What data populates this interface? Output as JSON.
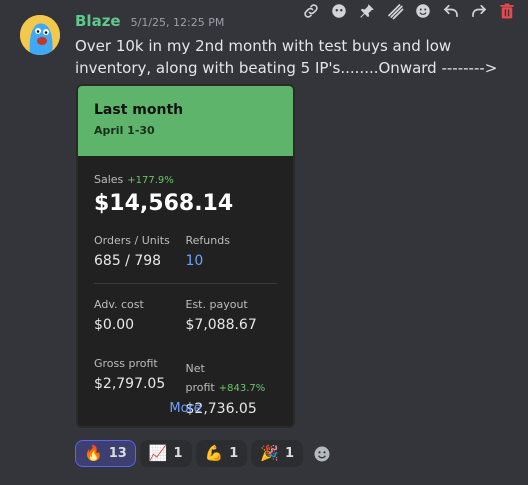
{
  "toolbar": {
    "icons": [
      "link-icon",
      "thread-icon",
      "pin-icon",
      "forward-icon",
      "emoji-icon",
      "reply-icon",
      "redo-icon",
      "delete-icon"
    ]
  },
  "message": {
    "username": "Blaze",
    "timestamp": "5/1/25, 12:25 PM",
    "text": "Over 10k in my 2nd month with test buys and low inventory, along with beating 5 IP's........Onward -------->"
  },
  "card": {
    "header": {
      "title": "Last month",
      "subtitle": "April 1-30"
    },
    "sales": {
      "label": "Sales",
      "delta": "+177.9%",
      "value": "$14,568.14"
    },
    "orders_units": {
      "label": "Orders / Units",
      "value": "685 / 798"
    },
    "refunds": {
      "label": "Refunds",
      "value": "10"
    },
    "adv_cost": {
      "label": "Adv. cost",
      "value": "$0.00"
    },
    "est_payout": {
      "label": "Est. payout",
      "value": "$7,088.67"
    },
    "gross_profit": {
      "label": "Gross profit",
      "value": "$2,797.05"
    },
    "net_profit": {
      "label": "Net profit",
      "delta": "+843.7%",
      "value": "$2,736.05"
    },
    "more_label": "More"
  },
  "reactions": [
    {
      "emoji": "🔥",
      "count": "13"
    },
    {
      "emoji": "📈",
      "count": "1"
    },
    {
      "emoji": "💪",
      "count": "1"
    },
    {
      "emoji": "🎉",
      "count": "1"
    }
  ],
  "colors": {
    "username": "#5ec98a",
    "card_header": "#5fb46b",
    "delta_green": "#6cc36f",
    "link_blue": "#6ea0ff"
  }
}
